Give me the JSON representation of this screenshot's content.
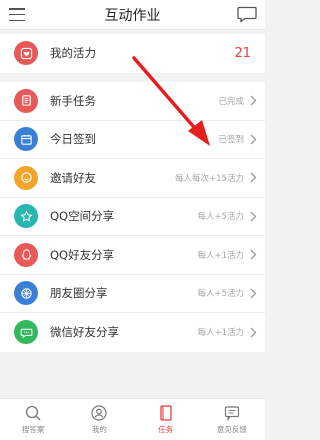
{
  "header": {
    "title": "互动作业"
  },
  "vitality": {
    "label": "我的活力",
    "value": "21"
  },
  "tasks": [
    {
      "label": "新手任务",
      "status": "已完成"
    },
    {
      "label": "今日签到",
      "status": "已签到"
    },
    {
      "label": "邀请好友",
      "status": "每人每次+15活力"
    },
    {
      "label": "QQ空间分享",
      "status": "每人+5活力"
    },
    {
      "label": "QQ好友分享",
      "status": "每人+1活力"
    },
    {
      "label": "朋友圈分享",
      "status": "每人+5活力"
    },
    {
      "label": "微信好友分享",
      "status": "每人+1活力"
    }
  ],
  "tabs": [
    {
      "label": "搜答案"
    },
    {
      "label": "我的"
    },
    {
      "label": "任务"
    },
    {
      "label": "意见反馈"
    }
  ],
  "colors": {
    "accent": "#e8413c",
    "icon_red": "#e85a58",
    "icon_blue": "#3a7fd6",
    "icon_orange": "#f3a52b",
    "icon_teal": "#27b7b0",
    "icon_green": "#33b85b"
  }
}
